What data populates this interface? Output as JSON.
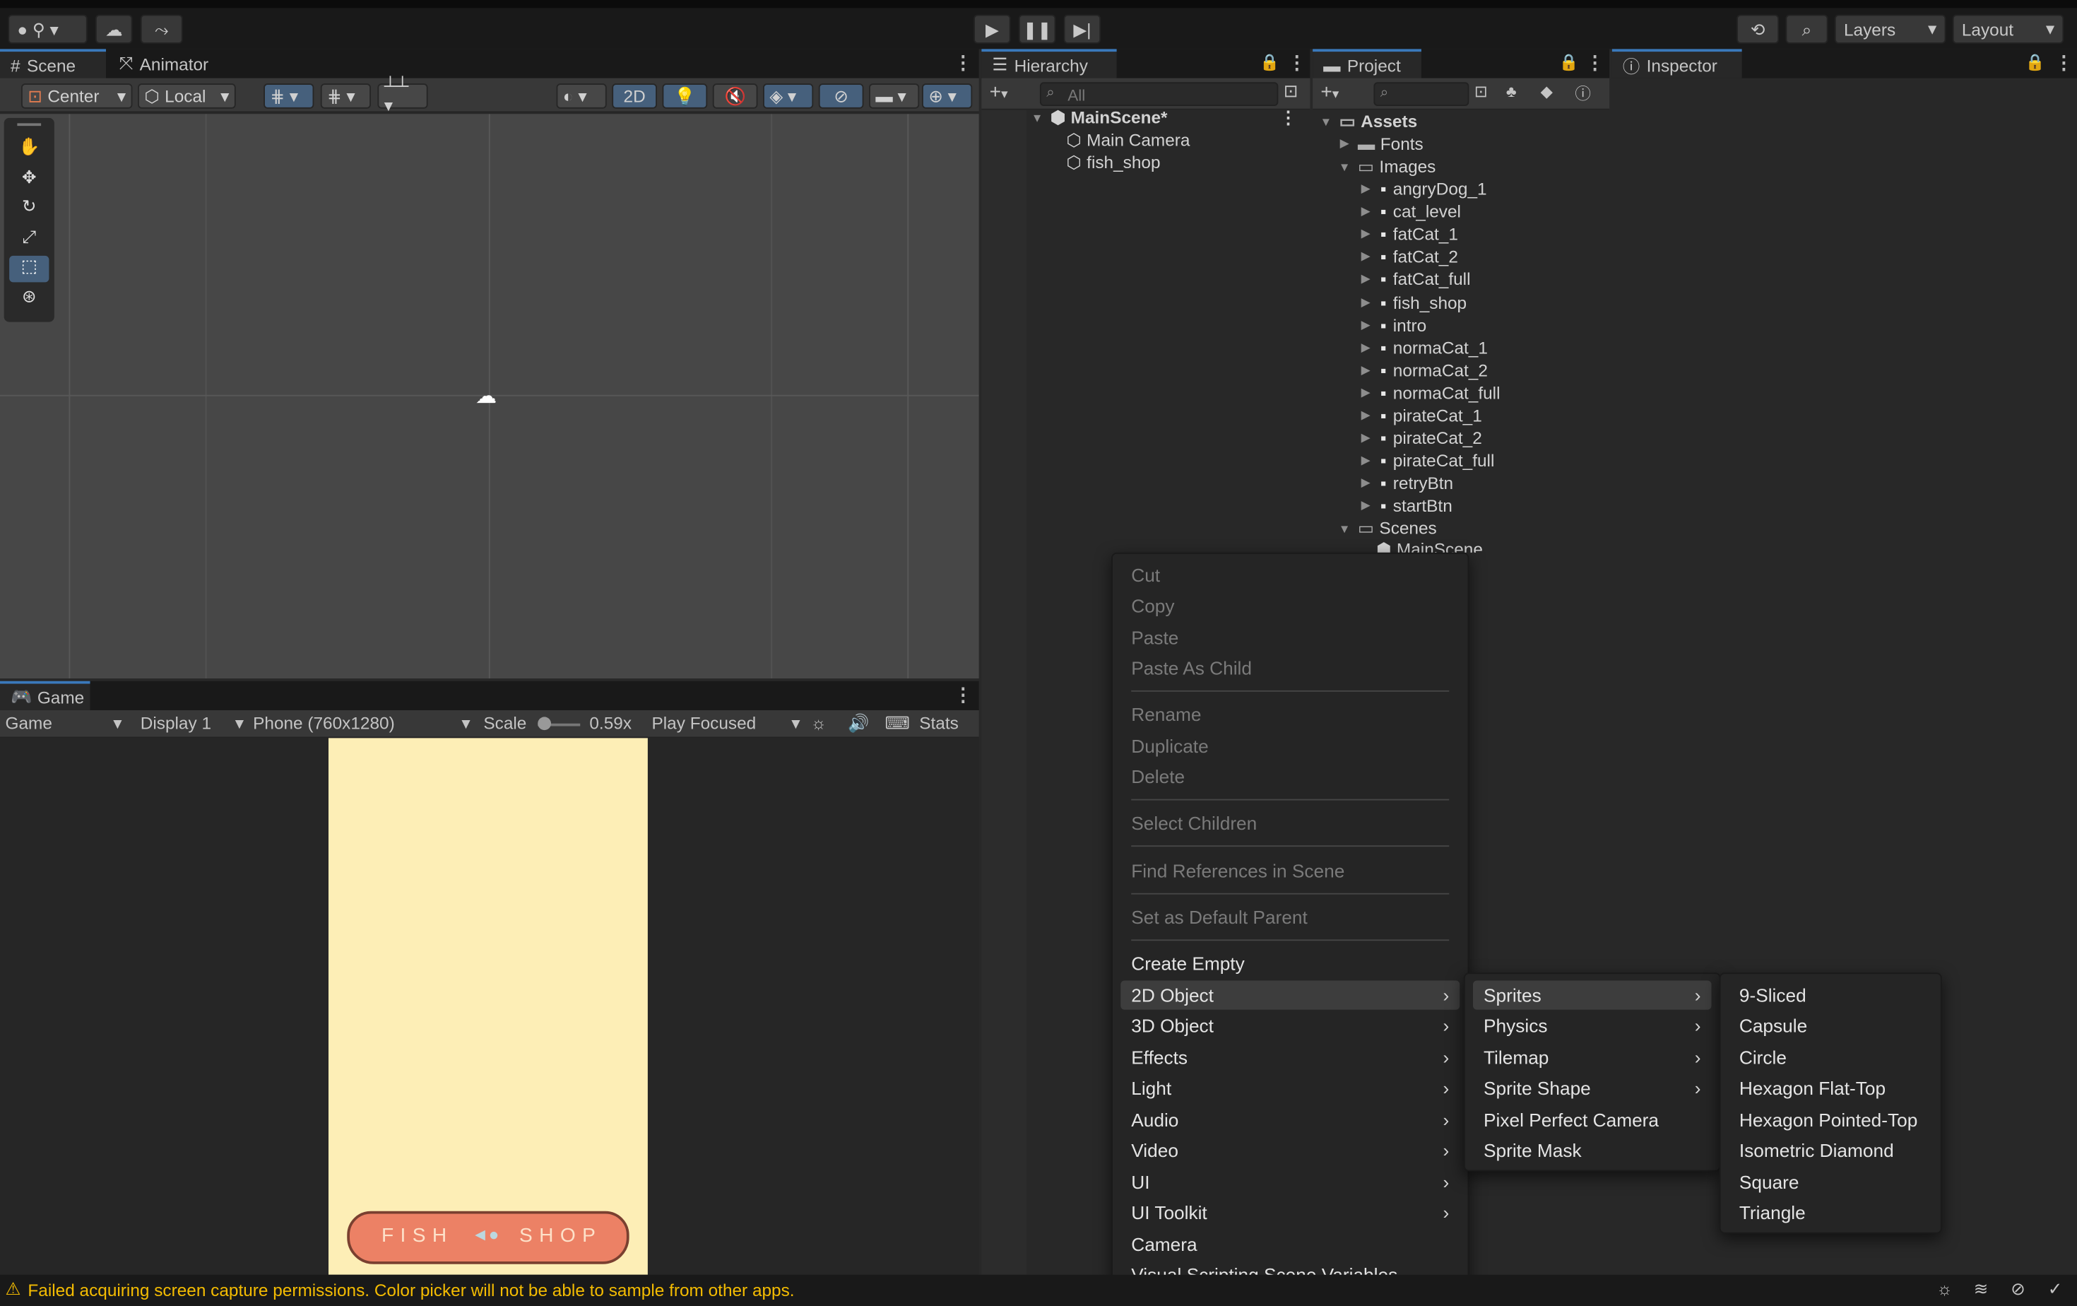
{
  "toolbar": {
    "layers": "Layers",
    "layout": "Layout"
  },
  "scene": {
    "tab": "Scene",
    "tab2": "Animator",
    "pivot": "Center",
    "space": "Local",
    "mode2d": "2D"
  },
  "game": {
    "tab": "Game",
    "view": "Game",
    "display": "Display 1",
    "resolution": "Phone (760x1280)",
    "scale_label": "Scale",
    "scale_value": "0.59x",
    "play_mode": "Play Focused",
    "stats": "Stats",
    "shop_title": "FISH",
    "shop_title2": "SHOP"
  },
  "hierarchy": {
    "tab": "Hierarchy",
    "search_placeholder": "All",
    "scene": "MainScene*",
    "items": [
      "Main Camera",
      "fish_shop"
    ]
  },
  "project": {
    "tab": "Project",
    "root": "Assets",
    "fonts": "Fonts",
    "images": "Images",
    "image_items": [
      "angryDog_1",
      "cat_level",
      "fatCat_1",
      "fatCat_2",
      "fatCat_full",
      "fish_shop",
      "intro",
      "normaCat_1",
      "normaCat_2",
      "normaCat_full",
      "pirateCat_1",
      "pirateCat_2",
      "pirateCat_full",
      "retryBtn",
      "startBtn"
    ],
    "scenes": "Scenes",
    "scene_item": "MainScene"
  },
  "inspector": {
    "tab": "Inspector"
  },
  "context_menu": {
    "disabled": [
      "Cut",
      "Copy",
      "Paste",
      "Paste As Child",
      "Rename",
      "Duplicate",
      "Delete",
      "Select Children",
      "Find References in Scene",
      "Set as Default Parent"
    ],
    "items": [
      "Create Empty",
      "2D Object",
      "3D Object",
      "Effects",
      "Light",
      "Audio",
      "Video",
      "UI",
      "UI Toolkit",
      "Camera",
      "Visual Scripting Scene Variables"
    ],
    "highlighted": "2D Object"
  },
  "submenu_2d": {
    "items": [
      "Sprites",
      "Physics",
      "Tilemap",
      "Sprite Shape",
      "Pixel Perfect Camera",
      "Sprite Mask"
    ],
    "highlighted": "Sprites"
  },
  "submenu_sprites": {
    "items": [
      "9-Sliced",
      "Capsule",
      "Circle",
      "Hexagon Flat-Top",
      "Hexagon Pointed-Top",
      "Isometric Diamond",
      "Square",
      "Triangle"
    ]
  },
  "status": {
    "message": "Failed acquiring screen capture permissions. Color picker will not be able to sample from other apps.",
    "warn_color": "#f4bc02"
  },
  "colors": {
    "game_bg": "#fdeeb6",
    "shop_awning": "#ec8165",
    "accent": "#3a79bb"
  }
}
